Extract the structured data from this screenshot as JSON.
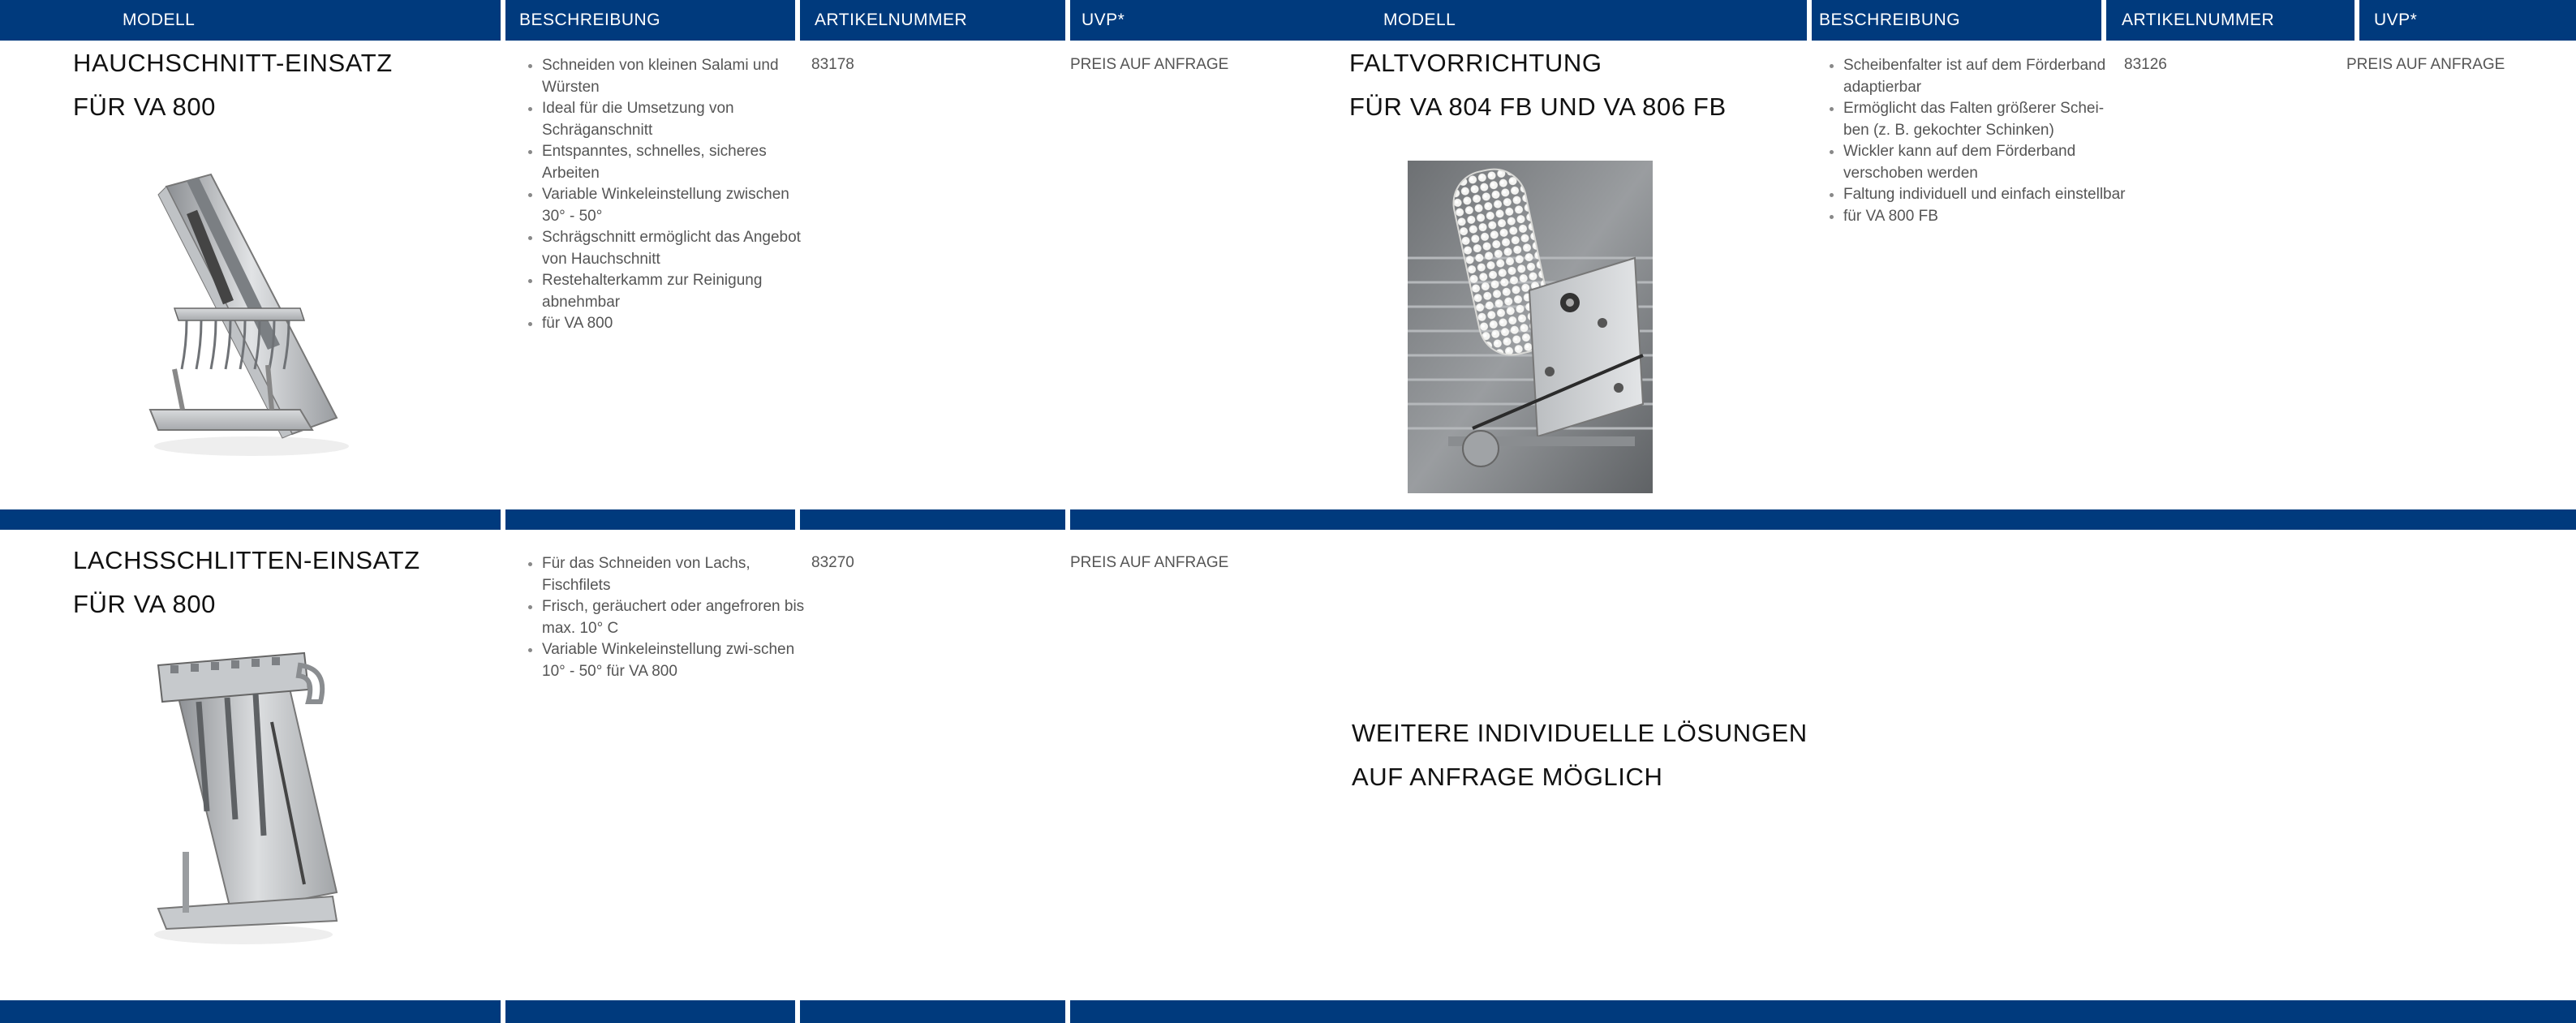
{
  "header": {
    "left": [
      "MODELL",
      "BESCHREIBUNG",
      "ARTIKELNUMMER",
      "UVP*"
    ],
    "right": [
      "MODELL",
      "BESCHREIBUNG",
      "ARTIKELNUMMER",
      "UVP*"
    ]
  },
  "products": [
    {
      "title_line1": "HAUCHSCHNITT-EINSATZ",
      "title_line2": "FÜR VA 800",
      "bullets": [
        "Schneiden von kleinen Salami und Würsten",
        "Ideal für die Umsetzung von Schräganschnitt",
        "Entspanntes, schnelles, sicheres Arbeiten",
        "Variable Winkeleinstellung zwischen 30° - 50°",
        "Schrägschnitt ermöglicht das Angebot von Hauchschnitt",
        "Restehalterkamm zur Reinigung abnehmbar",
        "für VA 800"
      ],
      "article": "83178",
      "price": "PREIS AUF ANFRAGE"
    },
    {
      "title_line1": "FALTVORRICHTUNG",
      "title_line2": "FÜR VA 804 FB UND VA 806 FB",
      "bullets": [
        "Scheibenfalter ist auf dem Förderband adaptierbar",
        "Ermöglicht das Falten größerer Schei-ben (z. B. gekochter Schinken)",
        "Wickler kann auf dem Förderband verschoben werden",
        "Faltung individuell und einfach einstellbar",
        "für VA 800 FB"
      ],
      "article": "83126",
      "price": "PREIS AUF ANFRAGE"
    },
    {
      "title_line1": "LACHSSCHLITTEN-EINSATZ",
      "title_line2": "FÜR VA 800",
      "bullets": [
        "Für das Schneiden von Lachs, Fischfilets",
        "Frisch, geräuchert oder angefroren bis max. 10° C",
        "Variable Winkeleinstellung zwi-schen 10° - 50° für VA 800"
      ],
      "article": "83270",
      "price": "PREIS AUF ANFRAGE"
    }
  ],
  "note": {
    "line1": "WEITERE INDIVIDUELLE LÖSUNGEN",
    "line2": "AUF ANFRAGE MÖGLICH"
  }
}
